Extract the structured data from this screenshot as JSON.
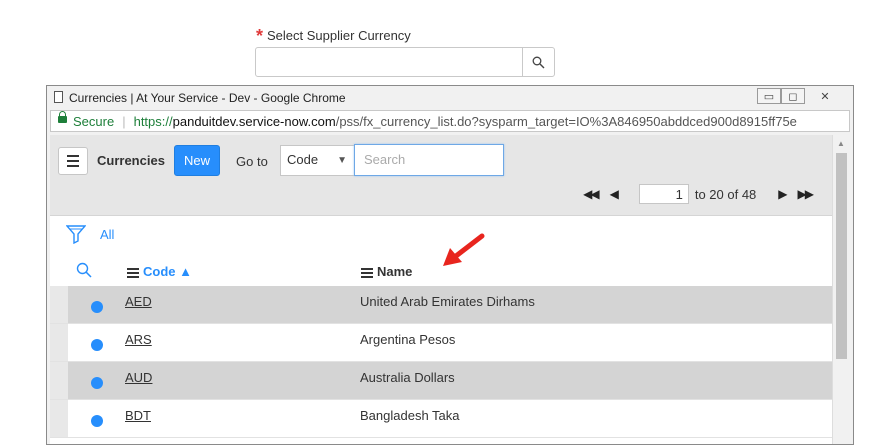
{
  "form": {
    "required_mark": "*",
    "field_label": "Select Supplier Currency",
    "field_value": ""
  },
  "window": {
    "title": "Currencies | At Your Service - Dev - Google Chrome",
    "controls": [
      "minimize",
      "restore",
      "close"
    ]
  },
  "address_bar": {
    "secure_label": "Secure",
    "scheme": "https://",
    "host": "panduitdev.service-now.com",
    "path": "/pss/fx_currency_list.do?sysparm_target=IO%3A846950abddced900d8915ff75e"
  },
  "list": {
    "title": "Currencies",
    "new_label": "New",
    "goto_label": "Go to",
    "goto_field": "Code",
    "search_placeholder": "Search",
    "filter_label": "All",
    "columns": {
      "code": "Code",
      "name": "Name"
    },
    "sort_indicator": "▲"
  },
  "pager": {
    "current": "1",
    "range_text": "to 20 of 48"
  },
  "rows": [
    {
      "code": "AED",
      "name": "United Arab Emirates Dirhams"
    },
    {
      "code": "ARS",
      "name": "Argentina Pesos"
    },
    {
      "code": "AUD",
      "name": "Australia Dollars"
    },
    {
      "code": "BDT",
      "name": "Bangladesh Taka"
    }
  ],
  "colors": {
    "accent": "#278efc",
    "required": "#e03a3a",
    "secure": "#1e7f3a",
    "annotation_arrow": "#e8251e"
  }
}
